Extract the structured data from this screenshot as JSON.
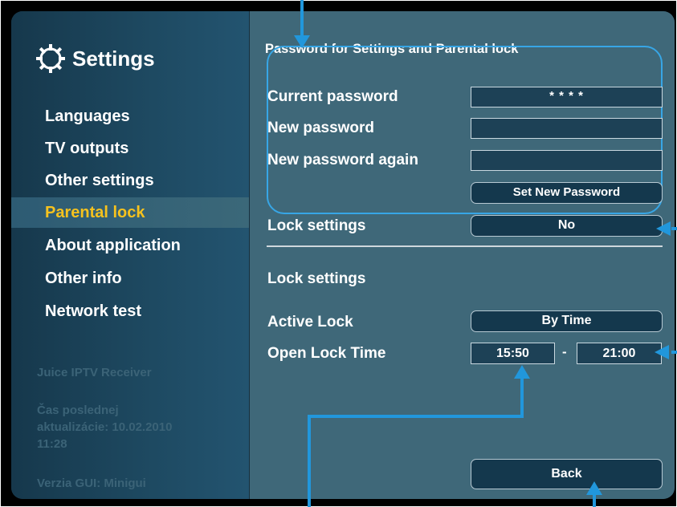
{
  "sidebar": {
    "title": "Settings",
    "items": [
      {
        "label": "Languages"
      },
      {
        "label": "TV outputs"
      },
      {
        "label": "Other settings"
      },
      {
        "label": "Parental lock"
      },
      {
        "label": "About  application"
      },
      {
        "label": "Other info"
      },
      {
        "label": "Network test"
      }
    ],
    "active_index": 3,
    "info": {
      "receiver": "Juice IPTV Receiver",
      "update_line1": "Čas poslednej",
      "update_line2": "aktualizácie: 10.02.2010",
      "update_line3": "11:28",
      "gui_version": "Verzia GUI: Minigui"
    }
  },
  "password_section": {
    "title": "Password for Settings and Parental lock",
    "current_label": "Current password",
    "current_value": "* * * *",
    "new_label": "New password",
    "new_value": "",
    "again_label": "New password again",
    "again_value": "",
    "set_button": "Set New Password"
  },
  "lock_top": {
    "label": "Lock settings",
    "value": "No"
  },
  "lock_section": {
    "heading": "Lock settings",
    "active_label": "Active Lock",
    "active_value": "By Time",
    "open_label": "Open Lock Time",
    "time_from": "15:50",
    "separator": "-",
    "time_to": "21:00"
  },
  "back_button": "Back",
  "colors": {
    "accent": "#f6c21e",
    "highlight": "#37a6e6",
    "panel": "#3f6879",
    "sidebar": "#1e4a62"
  }
}
